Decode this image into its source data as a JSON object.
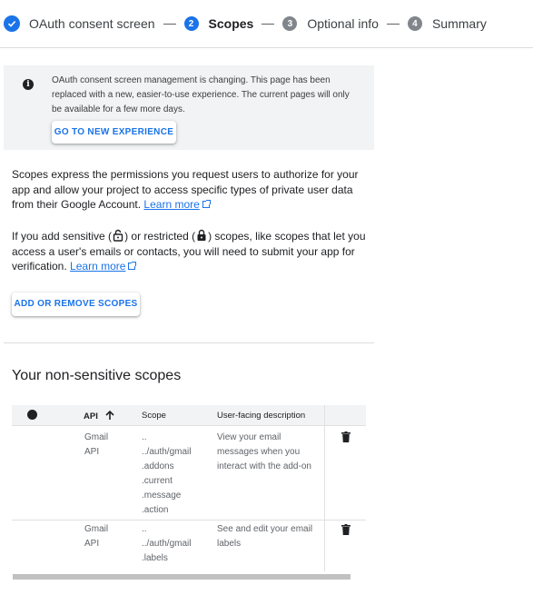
{
  "stepper": {
    "steps": [
      {
        "label": "OAuth consent screen"
      },
      {
        "num": "2",
        "label": "Scopes"
      },
      {
        "num": "3",
        "label": "Optional info"
      },
      {
        "num": "4",
        "label": "Summary"
      }
    ]
  },
  "notice": {
    "message": "OAuth consent screen management is changing. This page has been replaced with a new, easier-to-use experience. The current pages will only be available for a few more days.",
    "button": "GO TO NEW EXPERIENCE"
  },
  "intro": {
    "text": "Scopes express the permissions you request users to authorize for your app and allow your project to access specific types of private user data from their Google Account.",
    "link": "Learn more"
  },
  "sensitive": {
    "text_a": "If you add sensitive (",
    "text_b": ") or restricted (",
    "text_c": ") scopes, like scopes that let you access a user's emails or contacts, you will need to submit your app for verification.",
    "link": "Learn more"
  },
  "add_scopes_button": "ADD OR REMOVE SCOPES",
  "section_title": "Your non-sensitive scopes",
  "table": {
    "headers": {
      "api": "API",
      "scope": "Scope",
      "description": "User-facing description"
    },
    "rows": [
      {
        "api": [
          "Gmail",
          "API"
        ],
        "scope": [
          "..",
          "../auth/gmail",
          ".addons",
          ".current",
          ".message",
          ".action"
        ],
        "description": [
          "View your email",
          "messages when you",
          "interact with the add-on"
        ]
      },
      {
        "api": [
          "Gmail",
          "API"
        ],
        "scope": [
          "..",
          "../auth/gmail",
          ".labels"
        ],
        "description": [
          "See and edit your email",
          "labels"
        ]
      }
    ]
  },
  "colors": {
    "accent": "#1a73e8",
    "notice_bg": "#f1f3f4",
    "step_inactive": "#80868b"
  },
  "icons": [
    "check-circle-icon",
    "info-icon",
    "open-in-new-icon",
    "lock-open-icon",
    "lock-icon",
    "arrow-up-icon",
    "delete-icon"
  ]
}
